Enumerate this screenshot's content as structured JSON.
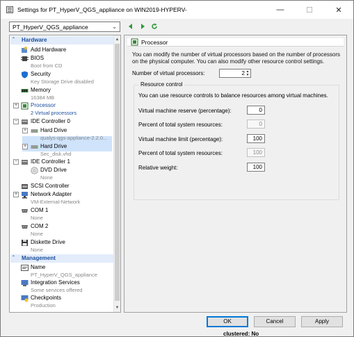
{
  "window": {
    "title": "Settings for PT_HyperV_QGS_appliance on WIN2019-HYPERV-",
    "minimize": "—",
    "maximize": "☐",
    "close": "✕"
  },
  "vm_selector": {
    "value": "PT_HyperV_QGS_appliance"
  },
  "tree": {
    "hardware_header": "Hardware",
    "add_hardware": "Add Hardware",
    "bios": {
      "label": "BIOS",
      "sub": "Boot from CD"
    },
    "security": {
      "label": "Security",
      "sub": "Key Storage Drive disabled"
    },
    "memory": {
      "label": "Memory",
      "sub": "16384 MB"
    },
    "processor": {
      "label": "Processor",
      "sub": "2 Virtual processors"
    },
    "ide0": {
      "label": "IDE Controller 0"
    },
    "hdd1": {
      "label": "Hard Drive",
      "sub": "qualys-qgs-appliance-2.2.0..."
    },
    "hdd2": {
      "label": "Hard Drive",
      "sub": "Sec_disk.vhd"
    },
    "ide1": {
      "label": "IDE Controller 1"
    },
    "dvd": {
      "label": "DVD Drive",
      "sub": "None"
    },
    "scsi": {
      "label": "SCSI Controller"
    },
    "nic": {
      "label": "Network Adapter",
      "sub": "VM-External-Network"
    },
    "com1": {
      "label": "COM 1",
      "sub": "None"
    },
    "com2": {
      "label": "COM 2",
      "sub": "None"
    },
    "diskette": {
      "label": "Diskette Drive",
      "sub": "None"
    },
    "management_header": "Management",
    "name": {
      "label": "Name",
      "sub": "PT_HyperV_QGS_appliance"
    },
    "integration": {
      "label": "Integration Services",
      "sub": "Some services offered"
    },
    "checkpoints": {
      "label": "Checkpoints",
      "sub": "Production"
    }
  },
  "processor_panel": {
    "header": "Processor",
    "description": "You can modify the number of virtual processors based on the number of processors on the physical computer. You can also modify other resource control settings.",
    "num_vcpu_label": "Number of virtual processors:",
    "num_vcpu_value": "2",
    "resource_control_title": "Resource control",
    "resource_desc": "You can use resource controls to balance resources among virtual machines.",
    "reserve_label": "Virtual machine reserve (percentage):",
    "reserve_value": "0",
    "reserve_pct_label": "Percent of total system resources:",
    "reserve_pct_value": "0",
    "limit_label": "Virtual machine limit (percentage):",
    "limit_value": "100",
    "limit_pct_label": "Percent of total system resources:",
    "limit_pct_value": "100",
    "weight_label": "Relative weight:",
    "weight_value": "100"
  },
  "buttons": {
    "ok": "OK",
    "cancel": "Cancel",
    "apply": "Apply"
  },
  "behind_window_text": "clustered: No",
  "colors": {
    "accent": "#0078d7",
    "section_header": "#1a4e9b",
    "selection": "#cfe3fb"
  }
}
